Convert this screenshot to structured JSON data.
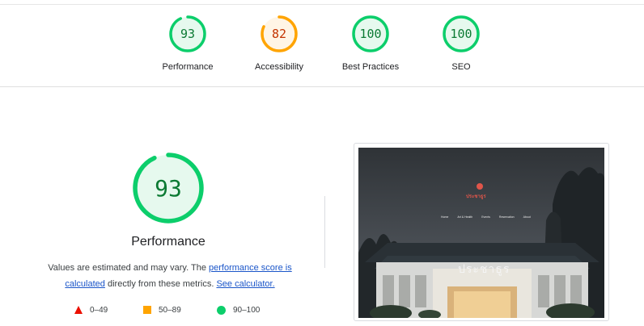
{
  "categories": [
    {
      "score": "93",
      "label": "Performance",
      "fraction": 0.93,
      "stroke": "#0cce6b",
      "fill": "#e6f9ee",
      "text": "#0c7a33"
    },
    {
      "score": "82",
      "label": "Accessibility",
      "fraction": 0.82,
      "stroke": "#ffa400",
      "fill": "#fff5e6",
      "text": "#c33300"
    },
    {
      "score": "100",
      "label": "Best Practices",
      "fraction": 1.0,
      "stroke": "#0cce6b",
      "fill": "#e6f9ee",
      "text": "#0c7a33"
    },
    {
      "score": "100",
      "label": "SEO",
      "fraction": 1.0,
      "stroke": "#0cce6b",
      "fill": "#e6f9ee",
      "text": "#0c7a33"
    }
  ],
  "main": {
    "score": "93",
    "fraction": 0.93,
    "title": "Performance",
    "desc_prefix": "Values are estimated and may vary. The ",
    "link_score": "performance score is calculated",
    "desc_middle": " directly from these metrics. ",
    "link_calc": "See calculator."
  },
  "legend": {
    "fail": "0–49",
    "average": "50–89",
    "pass": "90–100"
  },
  "screenshot": {
    "sign_text": "ประชาธูร",
    "logo_text": "ประชาธูร",
    "nav": [
      "Home",
      "Art & Health",
      "Events",
      "Reservation",
      "About"
    ]
  },
  "colors": {
    "pass": "#0cce6b",
    "average": "#ffa400",
    "fail": "#eb0f00",
    "link": "#1a55c9"
  }
}
